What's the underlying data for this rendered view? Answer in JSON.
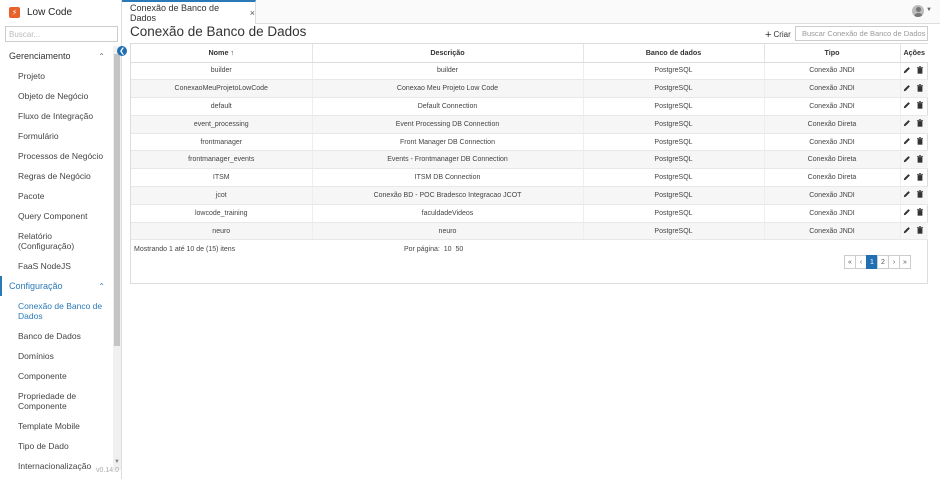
{
  "app": {
    "name": "Low Code",
    "version": "v0.14.0"
  },
  "sidebar": {
    "search_placeholder": "Buscar...",
    "groups": [
      {
        "label": "Gerenciamento",
        "items": [
          "Projeto",
          "Objeto de Negócio",
          "Fluxo de Integração",
          "Formulário",
          "Processos de Negócio",
          "Regras de Negócio",
          "Pacote",
          "Query Component",
          "Relatório (Configuração)",
          "FaaS NodeJS"
        ]
      },
      {
        "label": "Configuração",
        "items": [
          "Conexão de Banco de Dados",
          "Banco de Dados",
          "Domínios",
          "Componente",
          "Propriedade de Componente",
          "Template Mobile",
          "Tipo de Dado",
          "Internacionalização"
        ]
      }
    ]
  },
  "tab": {
    "label": "Conexão de Banco de Dados",
    "close": "×"
  },
  "page": {
    "title": "Conexão de Banco de Dados",
    "create_label": "Criar",
    "search_placeholder": "Buscar Conexão de Banco de Dados"
  },
  "table": {
    "columns": {
      "nome": "Nome ↑",
      "descricao": "Descrição",
      "banco": "Banco de dados",
      "tipo": "Tipo",
      "acoes": "Ações"
    },
    "rows": [
      {
        "nome": "builder",
        "descricao": "builder",
        "banco": "PostgreSQL",
        "tipo": "Conexão JNDI"
      },
      {
        "nome": "ConexaoMeuProjetoLowCode",
        "descricao": "Conexao Meu Projeto Low Code",
        "banco": "PostgreSQL",
        "tipo": "Conexão JNDI"
      },
      {
        "nome": "default",
        "descricao": "Default Connection",
        "banco": "PostgreSQL",
        "tipo": "Conexão JNDI"
      },
      {
        "nome": "event_processing",
        "descricao": "Event Processing DB Connection",
        "banco": "PostgreSQL",
        "tipo": "Conexão Direta"
      },
      {
        "nome": "frontmanager",
        "descricao": "Front Manager DB Connection",
        "banco": "PostgreSQL",
        "tipo": "Conexão JNDI"
      },
      {
        "nome": "frontmanager_events",
        "descricao": "Events - Frontmanager DB Connection",
        "banco": "PostgreSQL",
        "tipo": "Conexão Direta"
      },
      {
        "nome": "ITSM",
        "descricao": "ITSM DB Connection",
        "banco": "PostgreSQL",
        "tipo": "Conexão Direta"
      },
      {
        "nome": "jcot",
        "descricao": "Conexão BD - POC Bradesco Integracao JCOT",
        "banco": "PostgreSQL",
        "tipo": "Conexão JNDI"
      },
      {
        "nome": "lowcode_training",
        "descricao": "faculdadeVideos",
        "banco": "PostgreSQL",
        "tipo": "Conexão JNDI"
      },
      {
        "nome": "neuro",
        "descricao": "neuro",
        "banco": "PostgreSQL",
        "tipo": "Conexão JNDI"
      }
    ],
    "footer": {
      "showing": "Mostrando 1 até 10 de (15) itens",
      "per_page_label": "Por página:",
      "per_page_options": [
        "10",
        "50"
      ]
    },
    "pagination": {
      "first": "«",
      "prev": "‹",
      "pages": [
        "1",
        "2"
      ],
      "current": "1",
      "next": "›",
      "last": "»"
    }
  },
  "colors": {
    "accent": "#1f6fb2",
    "brand": "#e8612c"
  },
  "icons": [
    "edit-icon",
    "trash-icon",
    "user-avatar-icon",
    "plus-icon",
    "chevron-left-icon"
  ]
}
